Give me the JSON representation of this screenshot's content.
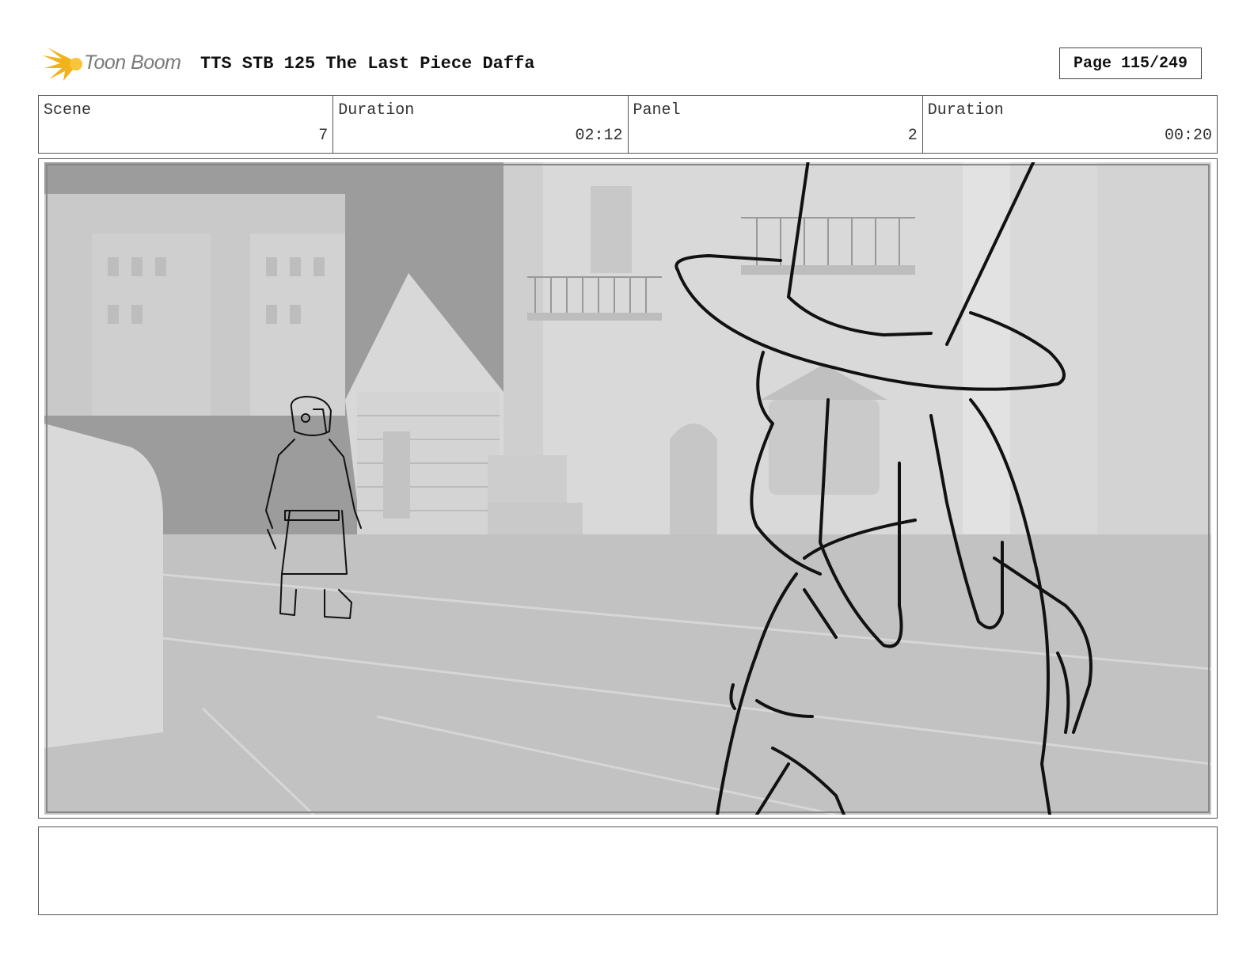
{
  "header": {
    "logo_text": "Toon Boom",
    "title": "TTS STB 125 The Last Piece Daffa",
    "page": "Page 115/249"
  },
  "info": {
    "scene_label": "Scene",
    "scene_value": "7",
    "scene_duration_label": "Duration",
    "scene_duration_value": "02:12",
    "panel_label": "Panel",
    "panel_value": "2",
    "panel_duration_label": "Duration",
    "panel_duration_value": "00:20"
  },
  "caption": {
    "text": ""
  },
  "colors": {
    "logo_yellow": "#f2b21c",
    "border": "#555555",
    "background_render": "#c8c8c8",
    "sketch_line": "#111111"
  }
}
